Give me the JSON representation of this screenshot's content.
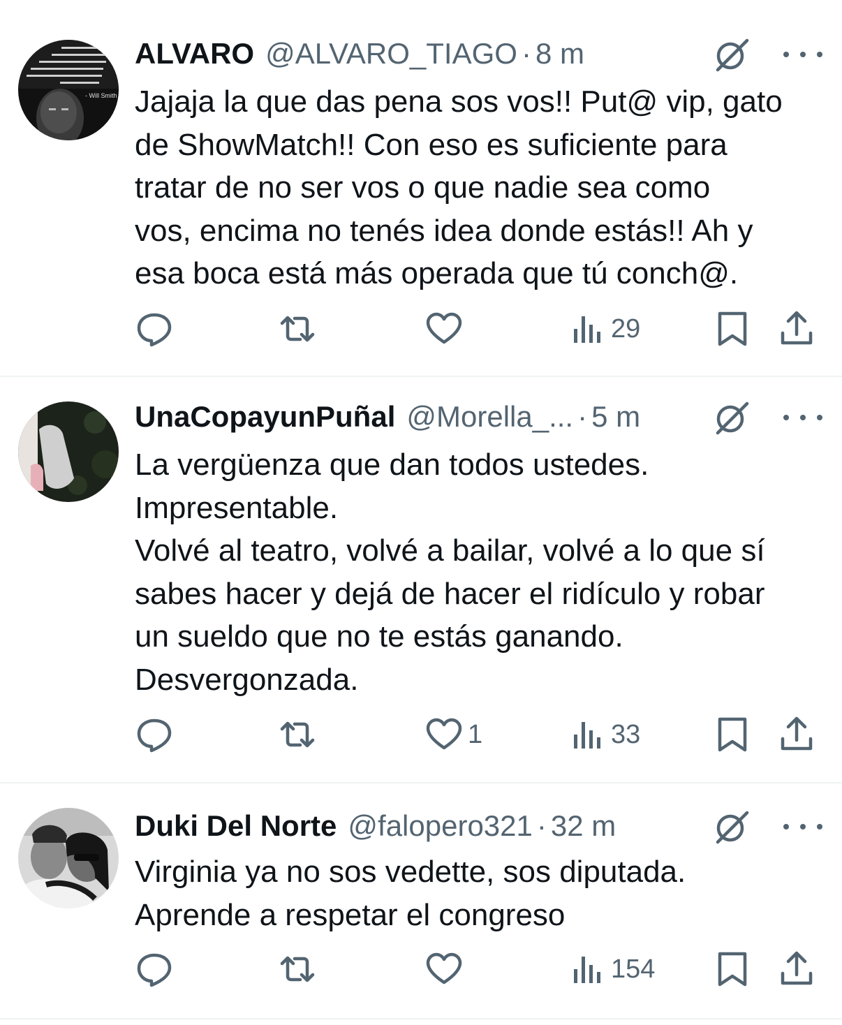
{
  "tweets": [
    {
      "name": "ALVARO",
      "handle": "@ALVARO_TIAGO",
      "separator": "·",
      "time": "8 m",
      "text": "Jajaja la que das pena sos vos!! Put@ vip, gato\nde ShowMatch!! Con eso es suficiente para\ntratar de no ser vos o que nadie sea como\nvos, encima no tenés idea donde estás!! Ah y\nesa boca está más operada que tú conch@.",
      "reply_count": "",
      "retweet_count": "",
      "like_count": "",
      "view_count": "29",
      "avatar_caption": "- Will Smith"
    },
    {
      "name": "UnaCopayunPuñal",
      "handle": "@Morella_...",
      "separator": "·",
      "time": "5 m",
      "text": "La vergüenza que dan todos ustedes.\nImpresentable.\nVolvé al teatro, volvé a bailar, volvé a lo que sí\nsabes hacer y dejá de hacer el ridículo y robar\nun sueldo que no te estás ganando.\nDesvergonzada.",
      "reply_count": "",
      "retweet_count": "",
      "like_count": "1",
      "view_count": "33"
    },
    {
      "name": "Duki Del Norte",
      "handle": "@falopero321",
      "separator": "·",
      "time": "32 m",
      "text": "Virginia ya no sos vedette, sos diputada.\nAprende a respetar el congreso",
      "reply_count": "",
      "retweet_count": "",
      "like_count": "",
      "view_count": "154"
    }
  ],
  "icons": {
    "reply": "reply-icon",
    "retweet": "retweet-icon",
    "like": "heart-icon",
    "views": "views-icon",
    "bookmark": "bookmark-icon",
    "share": "share-icon",
    "grok": "grok-icon",
    "more": "more-icon"
  },
  "colors": {
    "text": "#0f1419",
    "secondary": "#536471",
    "divider": "#eff3f4"
  }
}
